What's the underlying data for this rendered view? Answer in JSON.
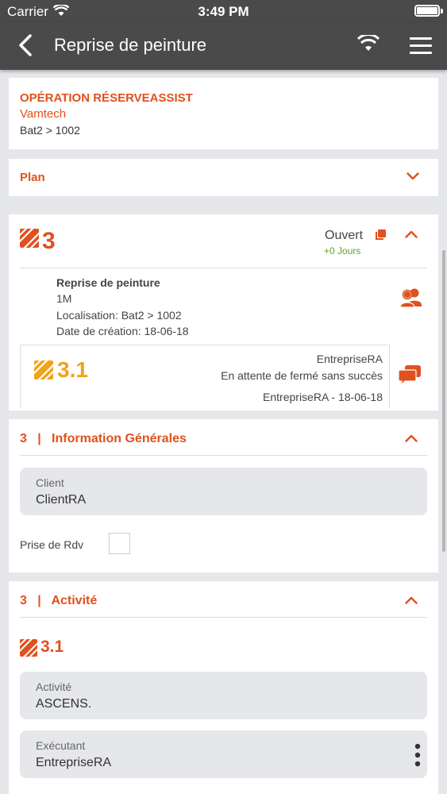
{
  "status_bar": {
    "carrier": "Carrier",
    "time": "3:49 PM"
  },
  "nav": {
    "title": "Reprise de peinture"
  },
  "operation": {
    "name": "OPÉRATION RÉSERVEASSIST",
    "company": "Vamtech",
    "location": "Bat2 > 1002"
  },
  "plan": {
    "label": "Plan"
  },
  "reserve": {
    "number": "3",
    "status": "Ouvert",
    "days": "+0 Jours",
    "title": "Reprise de peinture",
    "size": "1M",
    "localisation": "Localisation: Bat2 > 1002",
    "created": "Date de création: 18-06-18",
    "sub": {
      "number": "3.1",
      "company": "EntrepriseRA",
      "state": "En attente de fermé sans succès",
      "footer": "EntrepriseRA - 18-06-18"
    }
  },
  "info_section": {
    "title": "3   |   Information Générales",
    "client_label": "Client",
    "client_value": "ClientRA",
    "rdv_label": "Prise de Rdv"
  },
  "activity_section": {
    "title": "3   |   Activité",
    "number": "3.1",
    "activity_label": "Activité",
    "activity_value": "ASCENS.",
    "executant_label": "Exécutant",
    "executant_value": "EntrepriseRA"
  },
  "colors": {
    "accent": "#e0511d",
    "secondary": "#f0a31a",
    "nav_bg": "#4a4a4a",
    "success": "#5aa52a"
  }
}
